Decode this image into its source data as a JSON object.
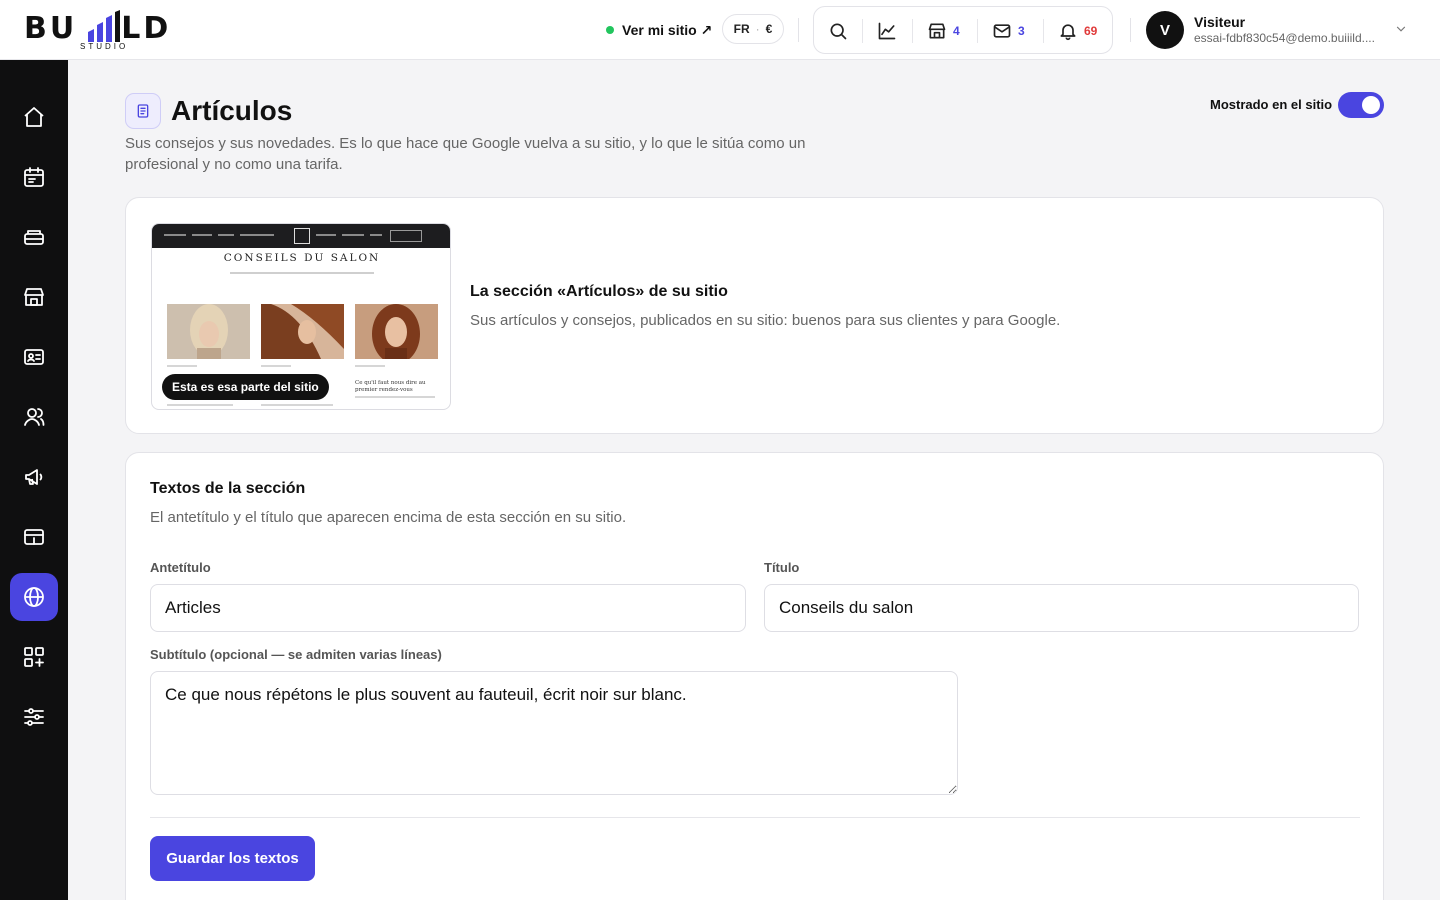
{
  "brand": {
    "logo_part1": "BU",
    "logo_part2": "LD",
    "logo_sub": "STUDIO"
  },
  "header": {
    "site_link": "Ver mi sitio ↗",
    "lang": "FR",
    "currency": "€",
    "establishments_count": "4",
    "messages_count": "3",
    "notifications_count": "69",
    "user_initial": "V",
    "user_name": "Visiteur",
    "user_email": "essai-fdbf830c54@demo.buiiild...."
  },
  "sidebar": {
    "items": [
      {
        "name": "home-icon"
      },
      {
        "name": "calendar-icon"
      },
      {
        "name": "services-icon"
      },
      {
        "name": "store-icon"
      },
      {
        "name": "contact-card-icon"
      },
      {
        "name": "users-icon"
      },
      {
        "name": "megaphone-icon"
      },
      {
        "name": "payment-card-icon"
      },
      {
        "name": "globe-icon",
        "active": true
      },
      {
        "name": "apps-icon"
      },
      {
        "name": "sliders-icon"
      }
    ]
  },
  "page": {
    "title": "Artículos",
    "description": "Sus consejos y sus novedades. Es lo que hace que Google vuelva a su sitio, y lo que le sitúa como un profesional y no como una tarifa.",
    "shown_label": "Mostrado en el sitio",
    "shown_on": true
  },
  "preview_card": {
    "preview_title": "CONSEILS DU SALON",
    "preview_article_title": "Ce qu'il faut nous dire au premier rendez-vous",
    "badge": "Esta es esa parte del sitio",
    "title": "La sección «Artículos» de su sitio",
    "description": "Sus artículos y consejos, publicados en su sitio: buenos para sus clientes y para Google."
  },
  "texts_card": {
    "title": "Textos de la sección",
    "description": "El antetítulo y el título que aparecen encima de esta sección en su sitio.",
    "kicker_label": "Antetítulo",
    "kicker_value": "Articles",
    "title_label": "Título",
    "title_value": "Conseils du salon",
    "subtitle_label": "Subtítulo (opcional — se admiten varias líneas)",
    "subtitle_value": "Ce que nous répétons le plus souvent au fauteuil, écrit noir sur blanc.",
    "save_label": "Guardar los textos"
  },
  "colors": {
    "accent": "#4a45e0",
    "sidebar_bg": "#0f0f10",
    "status_green": "#22c55e",
    "notification_red": "#e03a3a"
  }
}
